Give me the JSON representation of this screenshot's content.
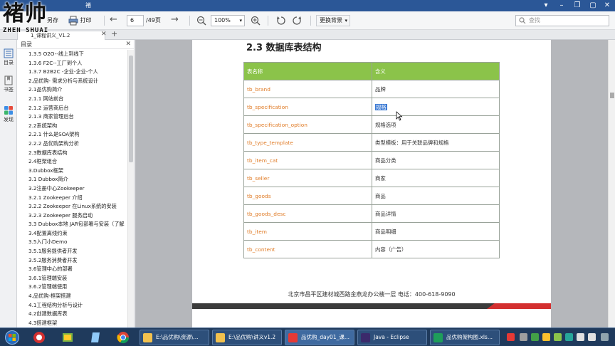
{
  "watermark": {
    "main": "褚帅",
    "sub": "ZHEN SHUAI"
  },
  "window": {
    "title_visible": "褚"
  },
  "toolbar": {
    "save_label": "另存",
    "print_label": "打印",
    "page_current": "6",
    "page_total": "/49页",
    "zoom": "100%",
    "background_label": "更换背景",
    "search_placeholder": "查找"
  },
  "tab": {
    "label": "1_课程讲义_V1.2"
  },
  "rail": {
    "items": [
      {
        "label": "目录"
      },
      {
        "label": "书签"
      },
      {
        "label": "发现"
      }
    ]
  },
  "outline": {
    "title": "目录",
    "items": [
      "1.3.5 O2O--线上到线下",
      "1.3.6 F2C--工厂到个人",
      "1.3.7 B2B2C -企业-企业-个人",
      "2.品优购- 需求分析与系统设计",
      "2.1品优购简介",
      "2.1.1 网站前台",
      "2.1.2 运营商后台",
      "2.1.3 商家管理后台",
      "2.2系统架构",
      "2.2.1 什么是SOA架构",
      "2.2.2 品优购架构分析",
      "2.3数据库表结构",
      "2.4框架组合",
      "3.Dubbox框架",
      "3.1 Dubbox简介",
      "3.2注册中心Zookeeper",
      "3.2.1 Zookeeper 介绍",
      "3.2.2 Zookeeper 在Linux系统的安装",
      "3.2.3 Zookeeper 服务启动",
      "3.3 Dubbox本地 JAR包部署与安装（了解",
      "3.4配置离线约束",
      "3.5入门小Demo",
      "3.5.1服务提供者开发",
      "3.5.2服务消费者开发",
      "3.6管理中心的部署",
      "3.6.1管理端安装",
      "3.6.2管理端使用",
      "4.品优购-框架搭建",
      "4.1工程结构分析与设计",
      "4.2创建数据库表",
      "4.3搭建框架"
    ]
  },
  "document": {
    "heading": "2.3 数据库表结构",
    "table": {
      "headers": [
        "表名称",
        "含义"
      ],
      "rows": [
        [
          "tb_brand",
          "品牌"
        ],
        [
          "tb_specification",
          "规格"
        ],
        [
          "tb_specification_option",
          "规格选项"
        ],
        [
          "tb_type_template",
          "类型模板：用于关联品牌和规格"
        ],
        [
          "tb_item_cat",
          "商品分类"
        ],
        [
          "tb_seller",
          "商家"
        ],
        [
          "tb_goods",
          "商品"
        ],
        [
          "tb_goods_desc",
          "商品详情"
        ],
        [
          "tb_item",
          "商品明细"
        ],
        [
          "tb_content",
          "内容（广告）"
        ]
      ]
    },
    "footer": "北京市昌平区建材城西路金燕龙办公楼一层     电话：400-618-9090"
  },
  "taskbar": {
    "tasks": [
      {
        "label": "E:\\品优购\\资源\\..."
      },
      {
        "label": "E:\\品优购\\讲义v1.2"
      },
      {
        "label": "品优购_day01_课..."
      },
      {
        "label": "Java - Eclipse"
      },
      {
        "label": "品优购架构图.xls..."
      }
    ]
  },
  "colors": {
    "table_header": "#8bc34a",
    "table_name_text": "#e07b26",
    "selection": "#3d7bd4",
    "taskbar": "#1f3a5c"
  }
}
